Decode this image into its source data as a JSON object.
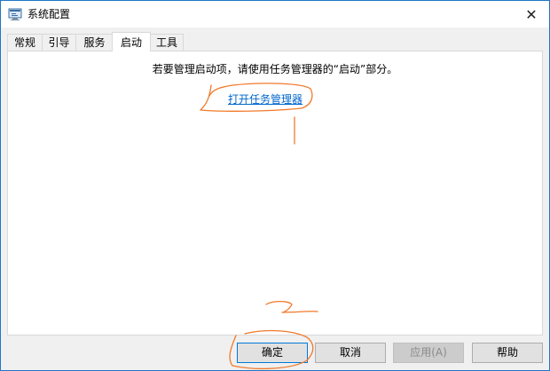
{
  "window": {
    "title": "系统配置",
    "close_glyph": "✕"
  },
  "tabs": [
    {
      "label": "常规"
    },
    {
      "label": "引导"
    },
    {
      "label": "服务"
    },
    {
      "label": "启动"
    },
    {
      "label": "工具"
    }
  ],
  "startup": {
    "info": "若要管理启动项，请使用任务管理器的“启动”部分。",
    "link": "打开任务管理器"
  },
  "buttons": {
    "ok": "确定",
    "cancel": "取消",
    "apply": "应用(A)",
    "help": "帮助"
  },
  "colors": {
    "accent": "#0078d7",
    "link": "#0066cc",
    "annotation": "#f07a2b"
  },
  "icons": {
    "app": "msconfig-icon",
    "close": "close-icon"
  }
}
